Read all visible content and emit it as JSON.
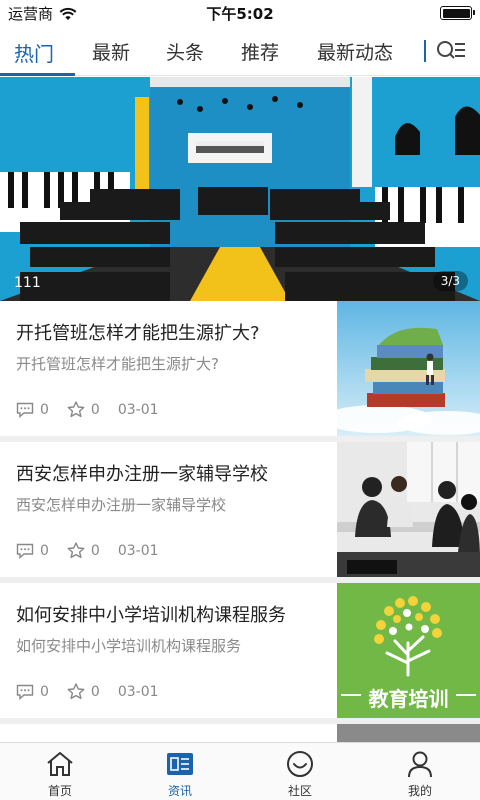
{
  "status_bar": {
    "carrier": "运营商",
    "time": "下午5:02"
  },
  "tabs": [
    {
      "label": "热门",
      "active": true
    },
    {
      "label": "最新",
      "active": false
    },
    {
      "label": "头条",
      "active": false
    },
    {
      "label": "推荐",
      "active": false
    },
    {
      "label": "最新动态",
      "active": false
    }
  ],
  "accent_color": "#1a64ad",
  "banner": {
    "caption": "111",
    "counter": "3/3"
  },
  "news": [
    {
      "title": "开托管班怎样才能把生源扩大?",
      "summary": "开托管班怎样才能把生源扩大?",
      "comments": "0",
      "stars": "0",
      "date": "03-01",
      "image": "books-stack-illustration"
    },
    {
      "title": "西安怎样申办注册一家辅导学校",
      "summary": "西安怎样申办注册一家辅导学校",
      "comments": "0",
      "stars": "0",
      "date": "03-01",
      "image": "classroom-photo"
    },
    {
      "title": "如何安排中小学培训机构课程服务",
      "summary": "如何安排中小学培训机构课程服务",
      "comments": "0",
      "stars": "0",
      "date": "03-01",
      "image": "education-training-logo",
      "image_text": "教育培训"
    }
  ],
  "bottom_nav": [
    {
      "label": "首页",
      "icon": "home-icon",
      "active": false
    },
    {
      "label": "资讯",
      "icon": "news-icon",
      "active": true
    },
    {
      "label": "社区",
      "icon": "community-icon",
      "active": false
    },
    {
      "label": "我的",
      "icon": "profile-icon",
      "active": false
    }
  ]
}
